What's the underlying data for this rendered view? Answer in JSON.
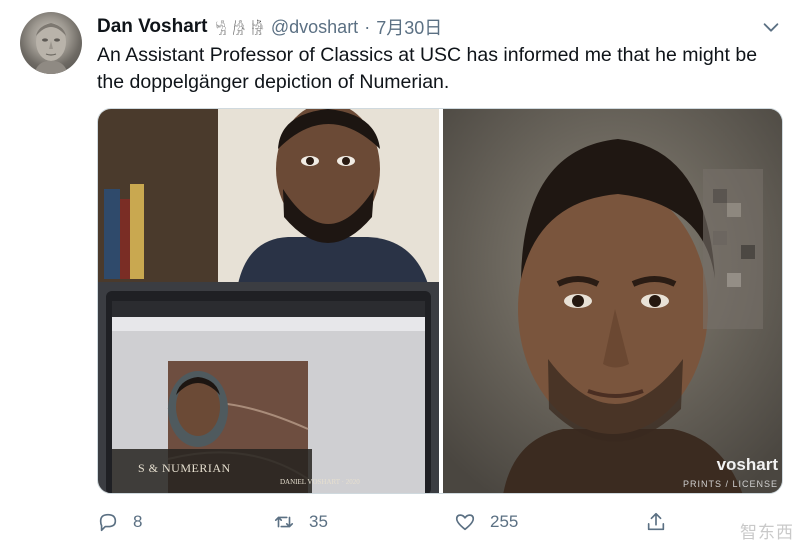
{
  "tweet": {
    "author_name": "Dan Voshart",
    "name_glyphs": "𓀜 𓀙 𓀛",
    "handle": "@dvoshart",
    "separator": "·",
    "date": "7月30日",
    "text": "An Assistant Professor of Classics at USC has informed me that he might be the doppelgänger depiction of Numerian."
  },
  "media": {
    "laptop_caption": "S & NUMERIAN",
    "laptop_subcaption": "DANIEL VOSHART · 2020",
    "watermark": "voshart",
    "watermark_sub": "PRINTS / LICENSE"
  },
  "actions": {
    "reply_count": "8",
    "retweet_count": "35",
    "like_count": "255"
  },
  "corner_watermark": "智东西",
  "icons": {
    "reply": "reply-icon",
    "retweet": "retweet-icon",
    "like": "heart-icon",
    "share": "share-icon",
    "more": "chevron-down-icon"
  },
  "colors": {
    "text": "#0f1419",
    "secondary": "#5b7083",
    "border": "#cfd9de"
  }
}
